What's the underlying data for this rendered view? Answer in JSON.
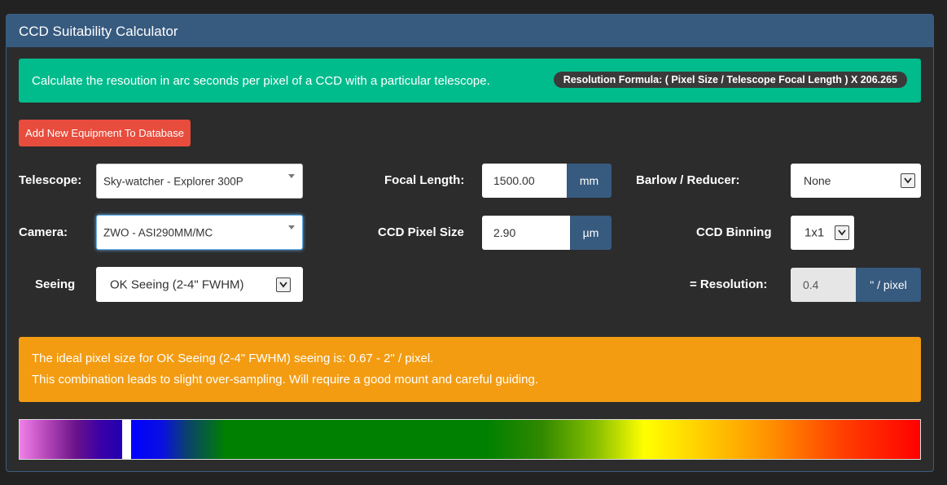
{
  "panel": {
    "title": "CCD Suitability Calculator"
  },
  "info": {
    "text": "Calculate the resoution in arc seconds per pixel of a CCD with a particular telescope.",
    "formula": "Resolution Formula:  (  Pixel Size  /  Telescope Focal Length  )  X 206.265"
  },
  "add_button": {
    "label": "Add New Equipment To Database"
  },
  "form": {
    "telescope": {
      "label": "Telescope:",
      "value": "Sky-watcher - Explorer 300P"
    },
    "camera": {
      "label": "Camera:",
      "value": "ZWO - ASI290MM/MC"
    },
    "seeing": {
      "label": "Seeing",
      "value": "OK Seeing (2-4\" FWHM)"
    },
    "focal_length": {
      "label": "Focal Length:",
      "value": "1500.00",
      "unit": "mm"
    },
    "pixel_size": {
      "label": "CCD Pixel Size",
      "value": "2.90",
      "unit": "µm"
    },
    "barlow": {
      "label": "Barlow / Reducer:",
      "value": "None"
    },
    "binning": {
      "label": "CCD Binning",
      "value": "1x1"
    },
    "resolution": {
      "label": "=  Resolution:",
      "value": "0.4",
      "unit": "\" / pixel"
    }
  },
  "result": {
    "line1": "The ideal pixel size for OK Seeing (2-4\" FWHM) seeing is: 0.67 - 2\" / pixel.",
    "line2": "This combination leads to slight over-sampling. Will require a good mount and careful guiding."
  },
  "colors": {
    "header": "#375a7f",
    "info_bar": "#00bc8c",
    "add_button": "#e74c3c",
    "warning": "#f39c12",
    "scale_marker": "#ffffff"
  },
  "scale_marker_position": 0.12
}
